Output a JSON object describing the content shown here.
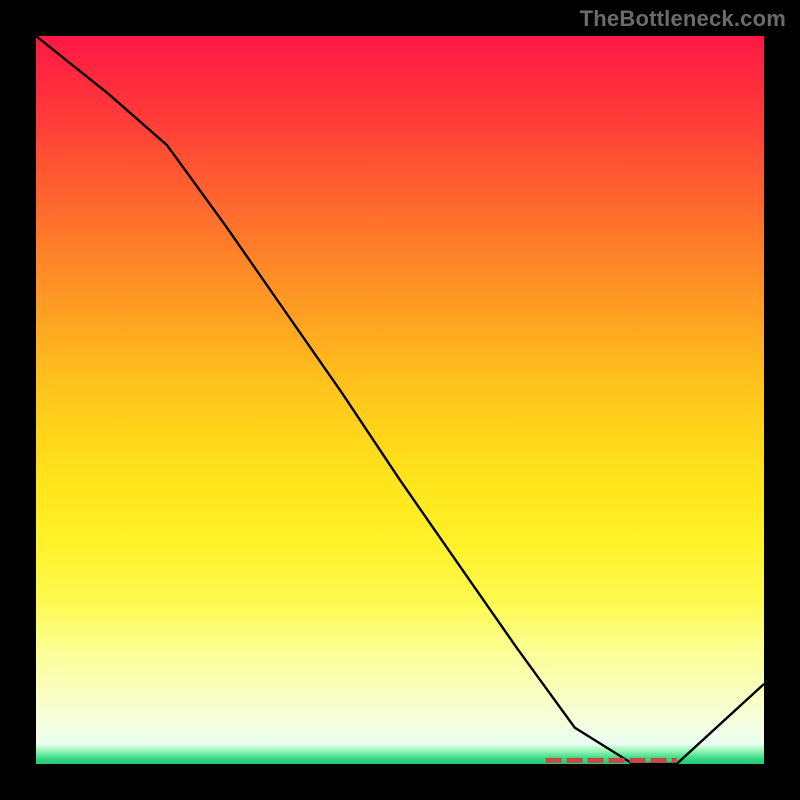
{
  "watermark": "TheBottleneck.com",
  "chart_data": {
    "type": "line",
    "title": "",
    "xlabel": "",
    "ylabel": "",
    "xlim": [
      0,
      100
    ],
    "ylim": [
      0,
      100
    ],
    "grid": false,
    "series": [
      {
        "name": "bottleneck-curve",
        "x": [
          0,
          10,
          18,
          26,
          34,
          42,
          50,
          58,
          66,
          74,
          82,
          88,
          100
        ],
        "y": [
          100,
          92,
          85,
          74,
          62.5,
          51,
          39,
          27.5,
          16,
          5,
          0,
          0,
          11
        ]
      }
    ],
    "annotations": [
      {
        "name": "sweet-spot-dashes",
        "x_start": 70,
        "x_end": 88,
        "y": 0.5
      }
    ],
    "background_gradient": {
      "direction": "top-to-bottom",
      "stops": [
        {
          "pos": 0.0,
          "color": "#ff1846"
        },
        {
          "pos": 0.5,
          "color": "#ffc31c"
        },
        {
          "pos": 0.8,
          "color": "#fdfa55"
        },
        {
          "pos": 0.93,
          "color": "#f8ffd5"
        },
        {
          "pos": 1.0,
          "color": "#27c770"
        }
      ]
    }
  }
}
